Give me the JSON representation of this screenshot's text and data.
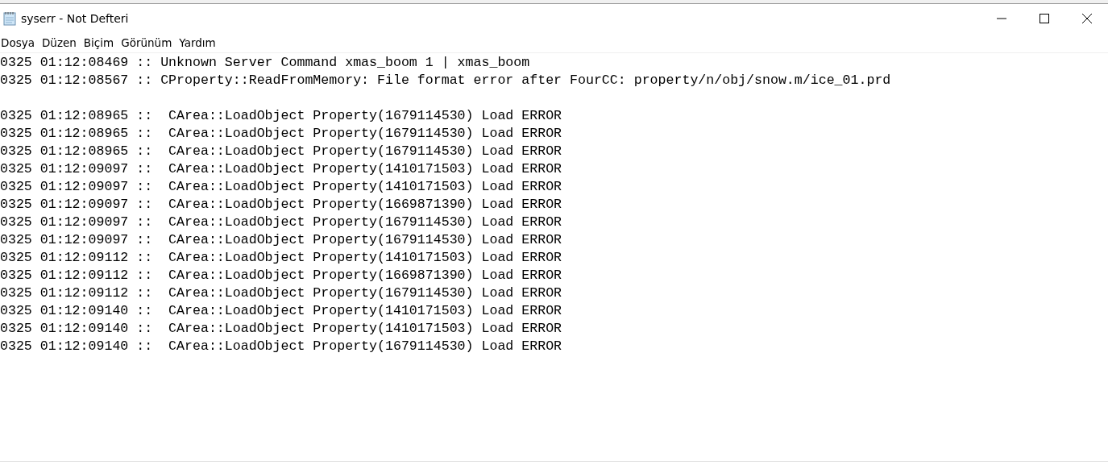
{
  "window": {
    "title": "syserr - Not Defteri"
  },
  "menu": [
    "Dosya",
    "Düzen",
    "Biçim",
    "Görünüm",
    "Yardım"
  ],
  "editor": {
    "blocks": [
      {
        "lines": [
          "0325 01:12:08469 :: Unknown Server Command xmas_boom 1 | xmas_boom",
          "0325 01:12:08567 :: CProperty::ReadFromMemory: File format error after FourCC: property/n/obj/snow.m/ice_01.prd"
        ]
      },
      {
        "lines": [
          "0325 01:12:08965 ::  CArea::LoadObject Property(1679114530) Load ERROR",
          "0325 01:12:08965 ::  CArea::LoadObject Property(1679114530) Load ERROR",
          "0325 01:12:08965 ::  CArea::LoadObject Property(1679114530) Load ERROR",
          "0325 01:12:09097 ::  CArea::LoadObject Property(1410171503) Load ERROR",
          "0325 01:12:09097 ::  CArea::LoadObject Property(1410171503) Load ERROR",
          "0325 01:12:09097 ::  CArea::LoadObject Property(1669871390) Load ERROR",
          "0325 01:12:09097 ::  CArea::LoadObject Property(1679114530) Load ERROR",
          "0325 01:12:09097 ::  CArea::LoadObject Property(1679114530) Load ERROR",
          "0325 01:12:09112 ::  CArea::LoadObject Property(1410171503) Load ERROR",
          "0325 01:12:09112 ::  CArea::LoadObject Property(1669871390) Load ERROR",
          "0325 01:12:09112 ::  CArea::LoadObject Property(1679114530) Load ERROR",
          "0325 01:12:09140 ::  CArea::LoadObject Property(1410171503) Load ERROR",
          "0325 01:12:09140 ::  CArea::LoadObject Property(1410171503) Load ERROR",
          "0325 01:12:09140 ::  CArea::LoadObject Property(1679114530) Load ERROR"
        ]
      }
    ]
  }
}
